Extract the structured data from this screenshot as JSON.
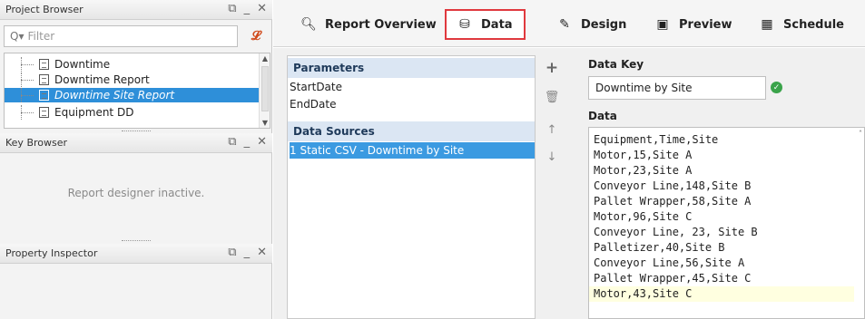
{
  "project_browser": {
    "title": "Project Browser",
    "filter_placeholder": "Filter",
    "items": [
      {
        "label": "Downtime"
      },
      {
        "label": "Downtime Report"
      },
      {
        "label": "Downtime Site Report",
        "selected": true
      },
      {
        "label": "Equipment DD"
      }
    ]
  },
  "key_browser": {
    "title": "Key Browser",
    "status": "Report designer inactive."
  },
  "property_inspector": {
    "title": "Property Inspector"
  },
  "panel_controls": {
    "restore": "⧉",
    "minimize": "_",
    "close": "✕"
  },
  "tabs": [
    {
      "label": "Report Overview",
      "icon": "report-overview-icon"
    },
    {
      "label": "Data",
      "icon": "database-icon",
      "active": true
    },
    {
      "label": "Design",
      "icon": "design-icon"
    },
    {
      "label": "Preview",
      "icon": "preview-icon"
    },
    {
      "label": "Schedule",
      "icon": "calendar-icon"
    }
  ],
  "parameters": {
    "header": "Parameters",
    "items": [
      "StartDate",
      "EndDate"
    ]
  },
  "data_sources": {
    "header": "Data Sources",
    "items": [
      {
        "label": "1 Static CSV - Downtime by Site",
        "selected": true
      }
    ]
  },
  "data_key": {
    "label": "Data Key",
    "value": "Downtime by Site"
  },
  "data": {
    "label": "Data",
    "lines": [
      "Equipment,Time,Site",
      "Motor,15,Site A",
      "Motor,23,Site A",
      "Conveyor Line,148,Site B",
      "Pallet Wrapper,58,Site A",
      "Motor,96,Site C",
      "Conveyor Line, 23, Site B",
      "Palletizer,40,Site B",
      "Conveyor Line,56,Site A",
      "Pallet Wrapper,45,Site C",
      "Motor,43,Site C"
    ]
  },
  "colors": {
    "active_tab_border": "#e0393e",
    "selection": "#2e8fd9",
    "section_header": "#dbe6f3",
    "ok": "#3aa34a"
  }
}
